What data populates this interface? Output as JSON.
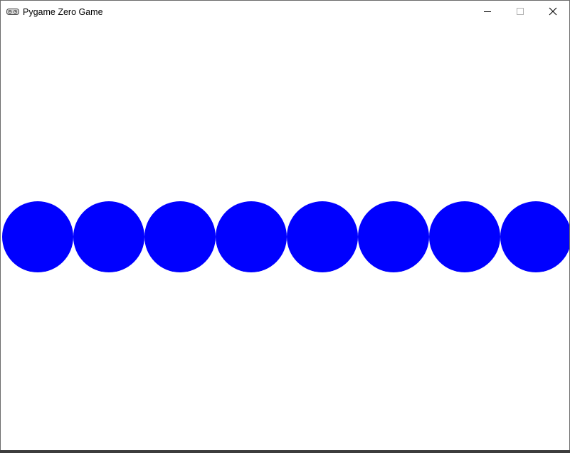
{
  "window": {
    "title": "Pygame Zero Game",
    "app_icon": "pygame-snake-icon",
    "controls": {
      "minimize_icon": "minimize-icon",
      "maximize_icon": "maximize-icon",
      "close_icon": "close-icon"
    }
  },
  "game": {
    "background_color": "#ffffff",
    "circle_color": "#0000ff",
    "circle_count": 8
  }
}
